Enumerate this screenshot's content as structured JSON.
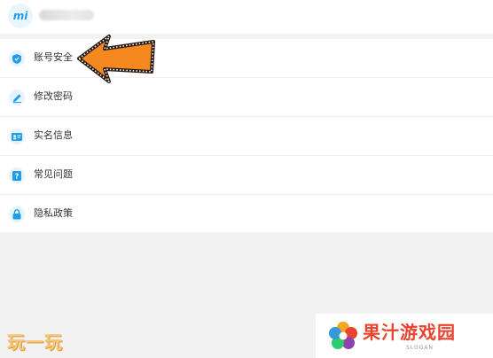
{
  "header": {
    "logo_text": "mi"
  },
  "menu": {
    "items": [
      {
        "label": "账号安全",
        "icon": "shield-icon"
      },
      {
        "label": "修改密码",
        "icon": "pencil-icon"
      },
      {
        "label": "实名信息",
        "icon": "id-card-icon"
      },
      {
        "label": "常见问题",
        "icon": "question-icon"
      },
      {
        "label": "隐私政策",
        "icon": "lock-icon"
      }
    ]
  },
  "annotation": {
    "arrow_color": "#f5891f",
    "arrow_target": "账号安全"
  },
  "watermark": {
    "left_text": "玩一玩",
    "brand_name": "果汁游戏园",
    "brand_slogan": "SLOGAN"
  },
  "colors": {
    "accent": "#1f9de8",
    "background": "#f2f2f2",
    "brand_red": "#e8432e"
  }
}
